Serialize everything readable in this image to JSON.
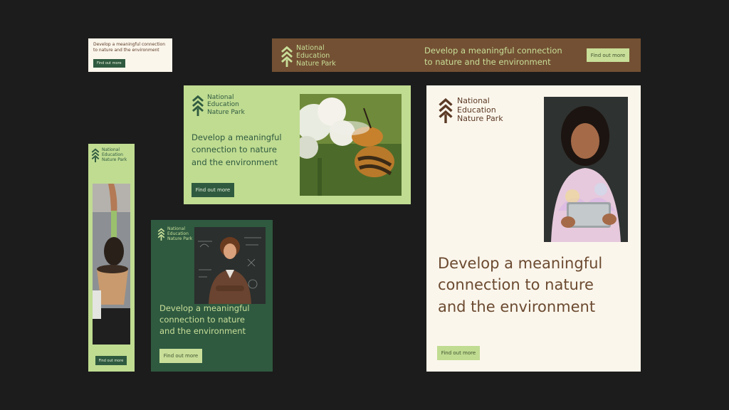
{
  "brand": {
    "name_lines": "National\nEducation\nNature Park",
    "tagline": "Develop a meaningful connection to nature and the environment",
    "tagline_two_lines": "Develop a meaningful connection\nto nature and the environment",
    "tagline_three_lines": "Develop a meaningful\nconnection to nature\nand the environment",
    "cta_label": "Find out more"
  },
  "colors": {
    "background": "#1c1c1c",
    "cream": "#fbf6ec",
    "brown": "#735033",
    "light_green": "#c0dc91",
    "dark_green": "#2f5a40",
    "text_brown": "#6b4a30"
  },
  "icons": {
    "logo": "stacked-chevron-tree-icon"
  },
  "photos": {
    "bee": "bee-on-clover-photo",
    "seedling": "hand-planting-in-pot-photo",
    "teacher": "teacher-at-chalkboard-photo",
    "girl": "girl-with-tablet-photo"
  }
}
